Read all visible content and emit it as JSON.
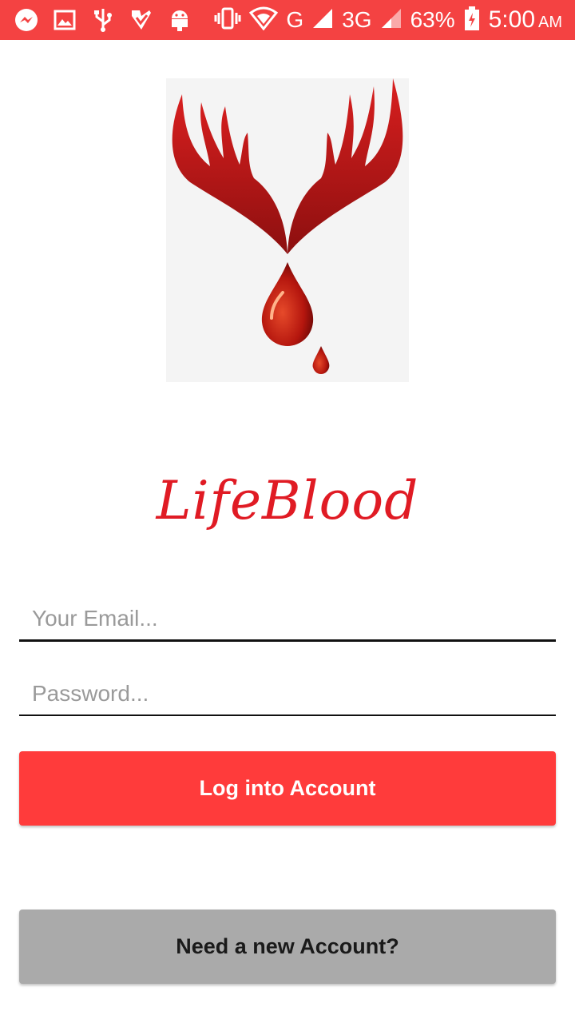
{
  "status_bar": {
    "network_g": "G",
    "network_3g": "3G",
    "battery": "63%",
    "time": "5:00",
    "ampm": "AM",
    "icons": [
      "messenger-icon",
      "gallery-icon",
      "usb-icon",
      "app-icon",
      "android-icon",
      "vibrate-icon",
      "wifi-icon",
      "signal-icon",
      "signal-icon",
      "battery-icon"
    ]
  },
  "app": {
    "title": "LifeBlood",
    "brand_color": "#e01b24"
  },
  "form": {
    "email_placeholder": "Your Email...",
    "email_value": "",
    "password_placeholder": "Password...",
    "password_value": ""
  },
  "buttons": {
    "login_label": "Log into Account",
    "signup_label": "Need a new Account?"
  },
  "colors": {
    "status_bar": "#f44242",
    "login_button": "#ff3b3b",
    "signup_button": "#aaaaaa"
  }
}
